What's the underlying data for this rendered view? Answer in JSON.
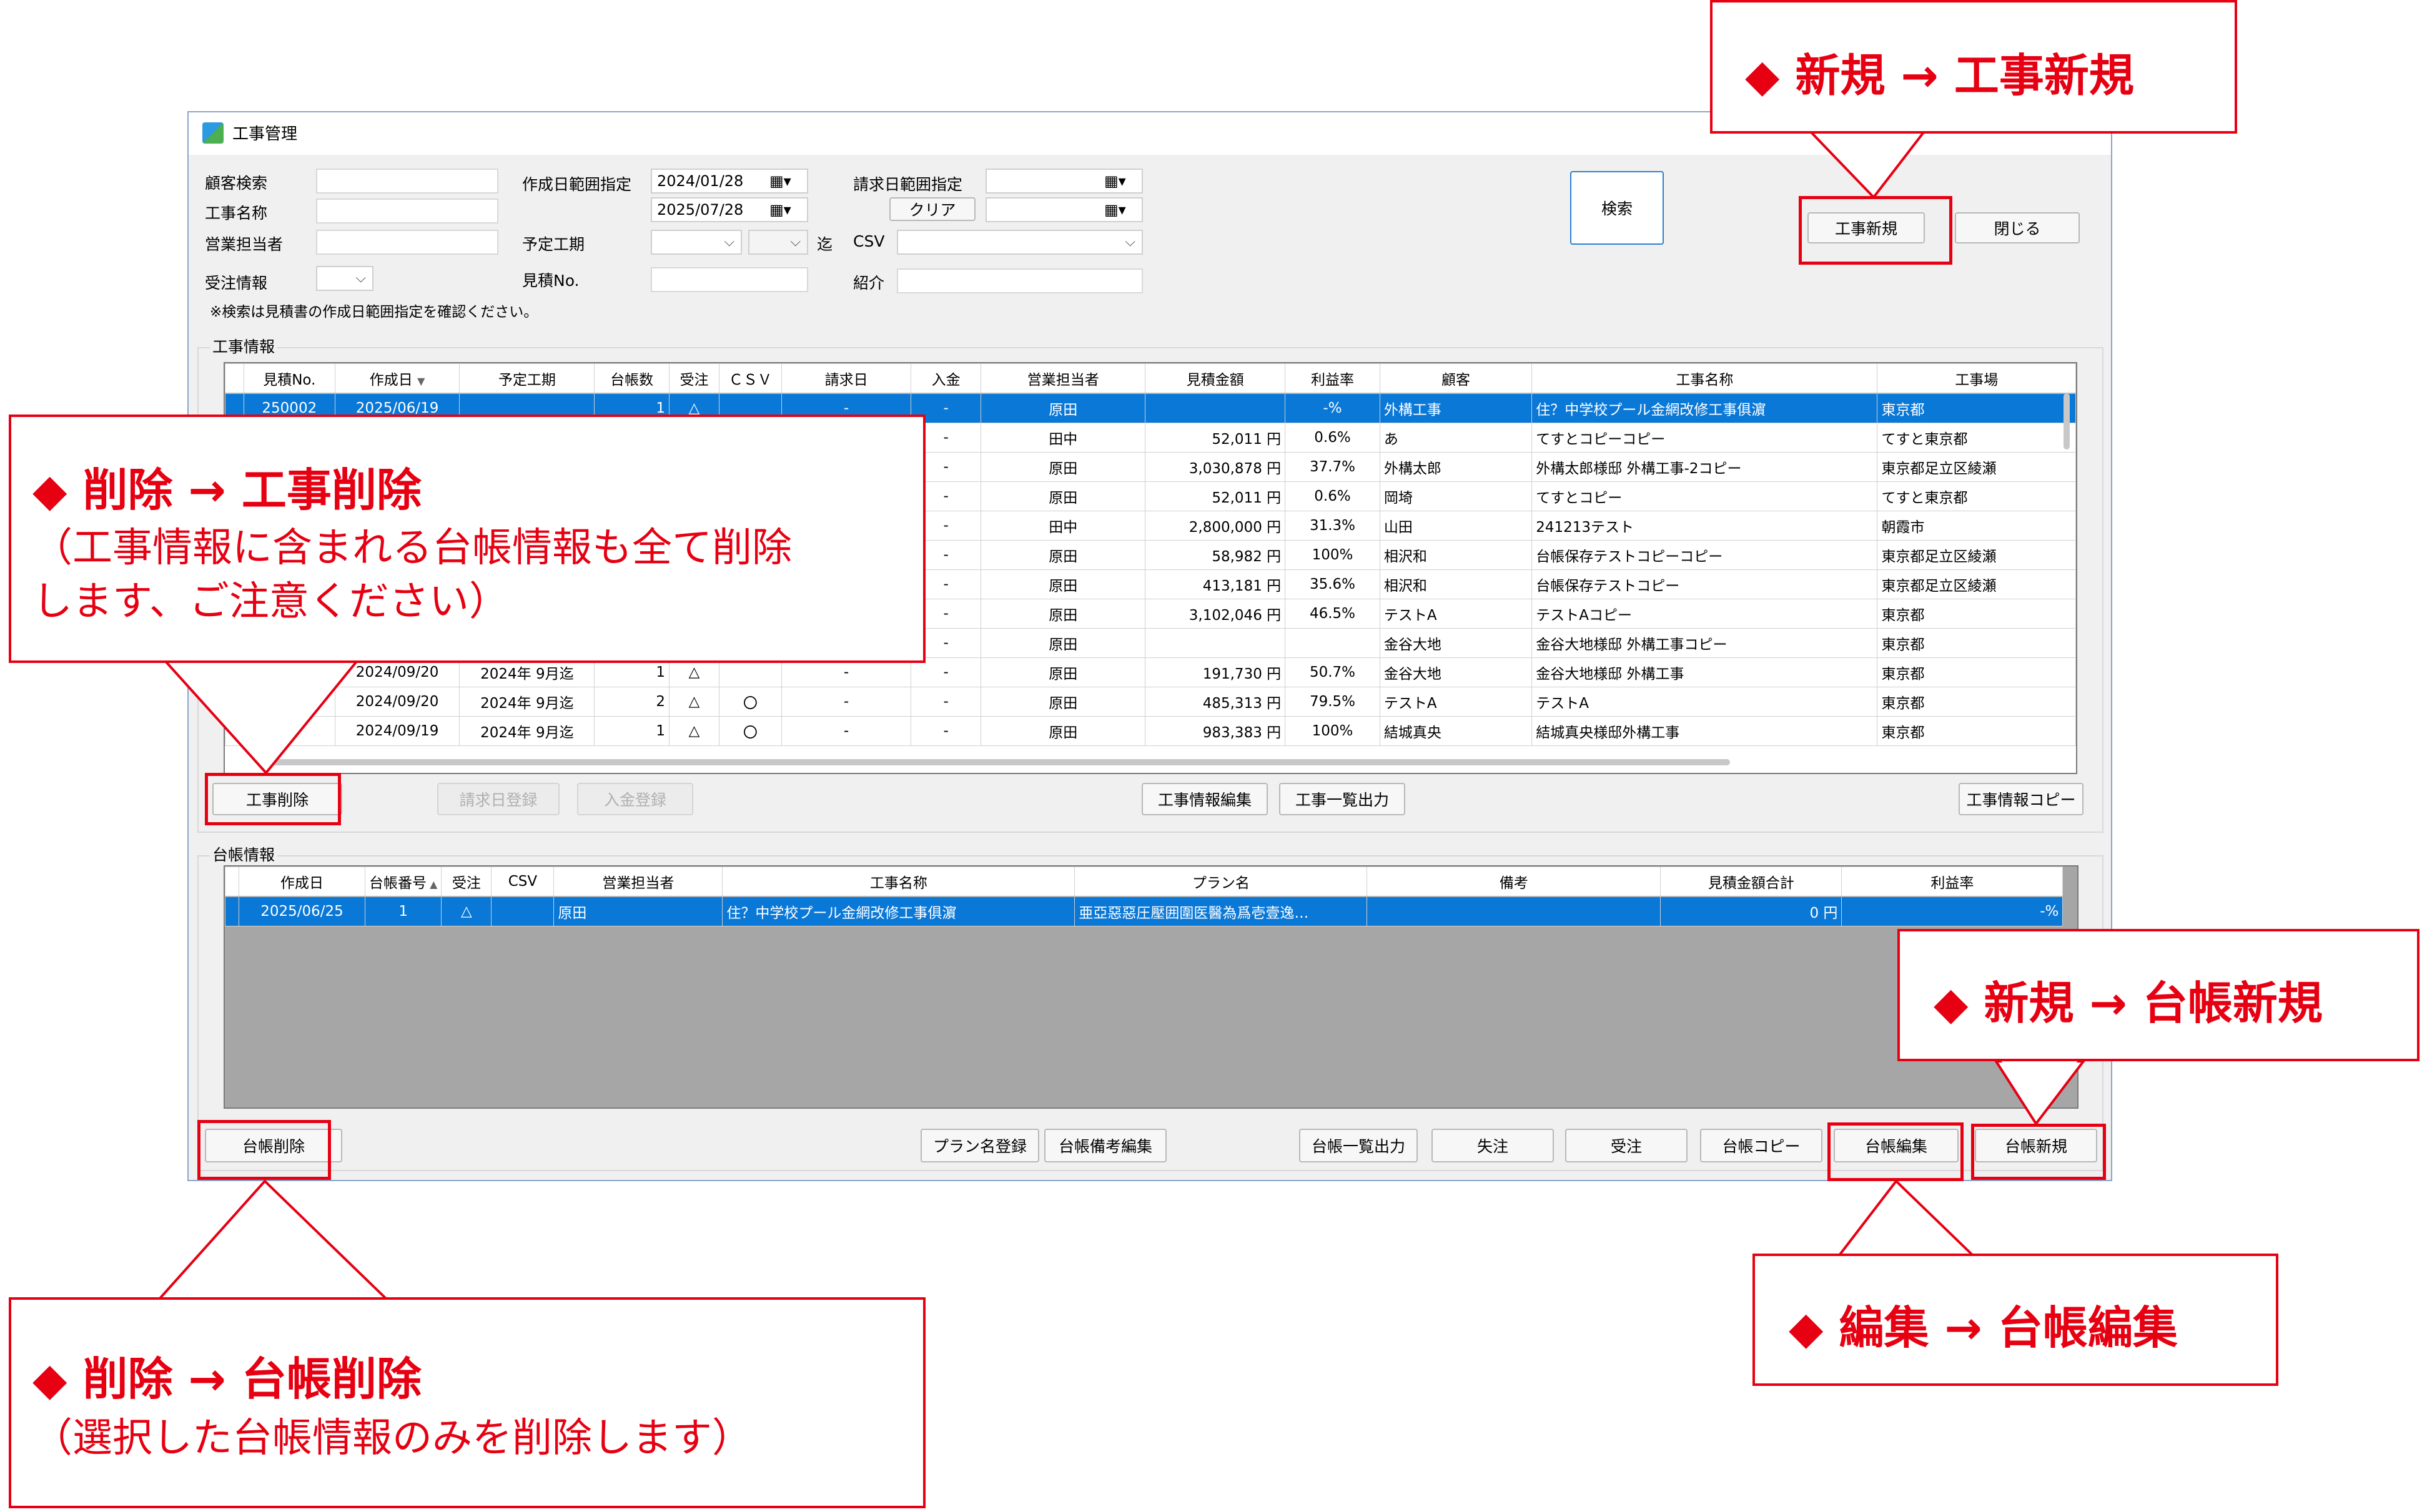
{
  "window": {
    "title": "工事管理",
    "minimize_glyph": "－"
  },
  "search": {
    "customer_label": "顧客検索",
    "project_name_label": "工事名称",
    "sales_rep_label": "営業担当者",
    "order_info_label": "受注情報",
    "created_range_label": "作成日範囲指定",
    "created_from": "2024/01/28",
    "created_to": "2025/07/28",
    "planned_period_label": "予定工期",
    "until_label": "迄",
    "estimate_no_label": "見積No.",
    "invoice_range_label": "請求日範囲指定",
    "clear_button": "クリア",
    "csv_label": "CSV",
    "intro_label": "紹介",
    "note": "※検索は見積書の作成日範囲指定を確認ください。",
    "search_button": "検索"
  },
  "top_buttons": {
    "new_project": "工事新規",
    "close": "閉じる"
  },
  "project_section": {
    "title": "工事情報",
    "columns": [
      "見積No.",
      "作成日",
      "予定工期",
      "台帳数",
      "受注",
      "ＣＳＶ",
      "請求日",
      "入金",
      "営業担当者",
      "見積金額",
      "利益率",
      "顧客",
      "工事名称",
      "工事場"
    ],
    "rows": [
      [
        "250002",
        "2025/06/19",
        "",
        "1",
        "△",
        "",
        "-",
        "-",
        "原田",
        "",
        "-%",
        "外構工事",
        "住？中学校プール金網改修工事俱濵",
        "東京都"
      ],
      [
        "",
        "",
        "",
        "",
        "",
        "",
        "",
        "-",
        "田中",
        "52,011 円",
        "0.6%",
        "あ",
        "てすとコピーコピー",
        "てすと東京都"
      ],
      [
        "",
        "",
        "",
        "",
        "",
        "",
        "",
        "-",
        "原田",
        "3,030,878 円",
        "37.7%",
        "外構太郎",
        "外構太郎様邸 外構工事-2コピー",
        "東京都足立区綾瀬"
      ],
      [
        "",
        "",
        "",
        "",
        "",
        "",
        "",
        "-",
        "原田",
        "52,011 円",
        "0.6%",
        "岡埼",
        "てすとコピー",
        "てすと東京都"
      ],
      [
        "",
        "",
        "",
        "",
        "",
        "",
        "",
        "-",
        "田中",
        "2,800,000 円",
        "31.3%",
        "山田",
        "241213テスト",
        "朝霞市"
      ],
      [
        "",
        "",
        "",
        "",
        "",
        "",
        "",
        "-",
        "原田",
        "58,982 円",
        "100%",
        "相沢和",
        "台帳保存テストコピーコピー",
        "東京都足立区綾瀬"
      ],
      [
        "",
        "",
        "",
        "",
        "",
        "",
        "",
        "-",
        "原田",
        "413,181 円",
        "35.6%",
        "相沢和",
        "台帳保存テストコピー",
        "東京都足立区綾瀬"
      ],
      [
        "",
        "",
        "",
        "",
        "",
        "",
        "",
        "-",
        "原田",
        "3,102,046 円",
        "46.5%",
        "テストA",
        "テストAコピー",
        "東京都"
      ],
      [
        "",
        "",
        "",
        "",
        "",
        "",
        "",
        "-",
        "原田",
        "",
        "",
        "金谷大地",
        "金谷大地様邸 外構工事コピー",
        "東京都"
      ],
      [
        "",
        "2024/09/20",
        "2024年 9月迄",
        "1",
        "△",
        "",
        "-",
        "-",
        "原田",
        "191,730 円",
        "50.7%",
        "金谷大地",
        "金谷大地様邸 外構工事",
        "東京都"
      ],
      [
        "",
        "2024/09/20",
        "2024年 9月迄",
        "2",
        "△",
        "〇",
        "-",
        "-",
        "原田",
        "485,313 円",
        "79.5%",
        "テストA",
        "テストA",
        "東京都"
      ],
      [
        "",
        "2024/09/19",
        "2024年 9月迄",
        "1",
        "△",
        "〇",
        "-",
        "-",
        "原田",
        "983,383 円",
        "100%",
        "結城真央",
        "結城真央様邸外構工事",
        "東京都"
      ]
    ],
    "buttons": {
      "delete": "工事削除",
      "invoice_register": "請求日登録",
      "payment_register": "入金登録",
      "edit": "工事情報編集",
      "list_output": "工事一覧出力",
      "copy": "工事情報コピー"
    }
  },
  "ledger_section": {
    "title": "台帳情報",
    "columns": [
      "作成日",
      "台帳番号",
      "受注",
      "CSV",
      "営業担当者",
      "工事名称",
      "プラン名",
      "備考",
      "見積金額合計",
      "利益率"
    ],
    "rows": [
      [
        "2025/06/25",
        "1",
        "△",
        "",
        "原田",
        "住？中学校プール金網改修工事俱濵",
        "亜亞惡惡圧壓囲圍医醫為爲壱壹逸…",
        "",
        "0 円",
        "-%"
      ]
    ],
    "buttons": {
      "delete": "台帳削除",
      "plan_register": "プラン名登録",
      "note_edit": "台帳備考編集",
      "list_output": "台帳一覧出力",
      "lost": "失注",
      "order": "受注",
      "copy": "台帳コピー",
      "edit": "台帳編集",
      "new": "台帳新規"
    }
  },
  "callouts": {
    "new_project": {
      "title": "◆ 新規 → 工事新規"
    },
    "delete_project": {
      "title": "◆ 削除 → 工事削除",
      "line1": "（工事情報に含まれる台帳情報も全て削除",
      "line2": "します、ご注意ください）"
    },
    "new_ledger": {
      "title": "◆ 新規 → 台帳新規"
    },
    "edit_ledger": {
      "title": "◆ 編集 → 台帳編集"
    },
    "delete_ledger": {
      "title": "◆ 削除 → 台帳削除",
      "line1": "（選択した台帳情報のみを削除します）"
    }
  },
  "colors": {
    "accent_red": "#e60012",
    "selection_blue": "#0a78d7"
  }
}
